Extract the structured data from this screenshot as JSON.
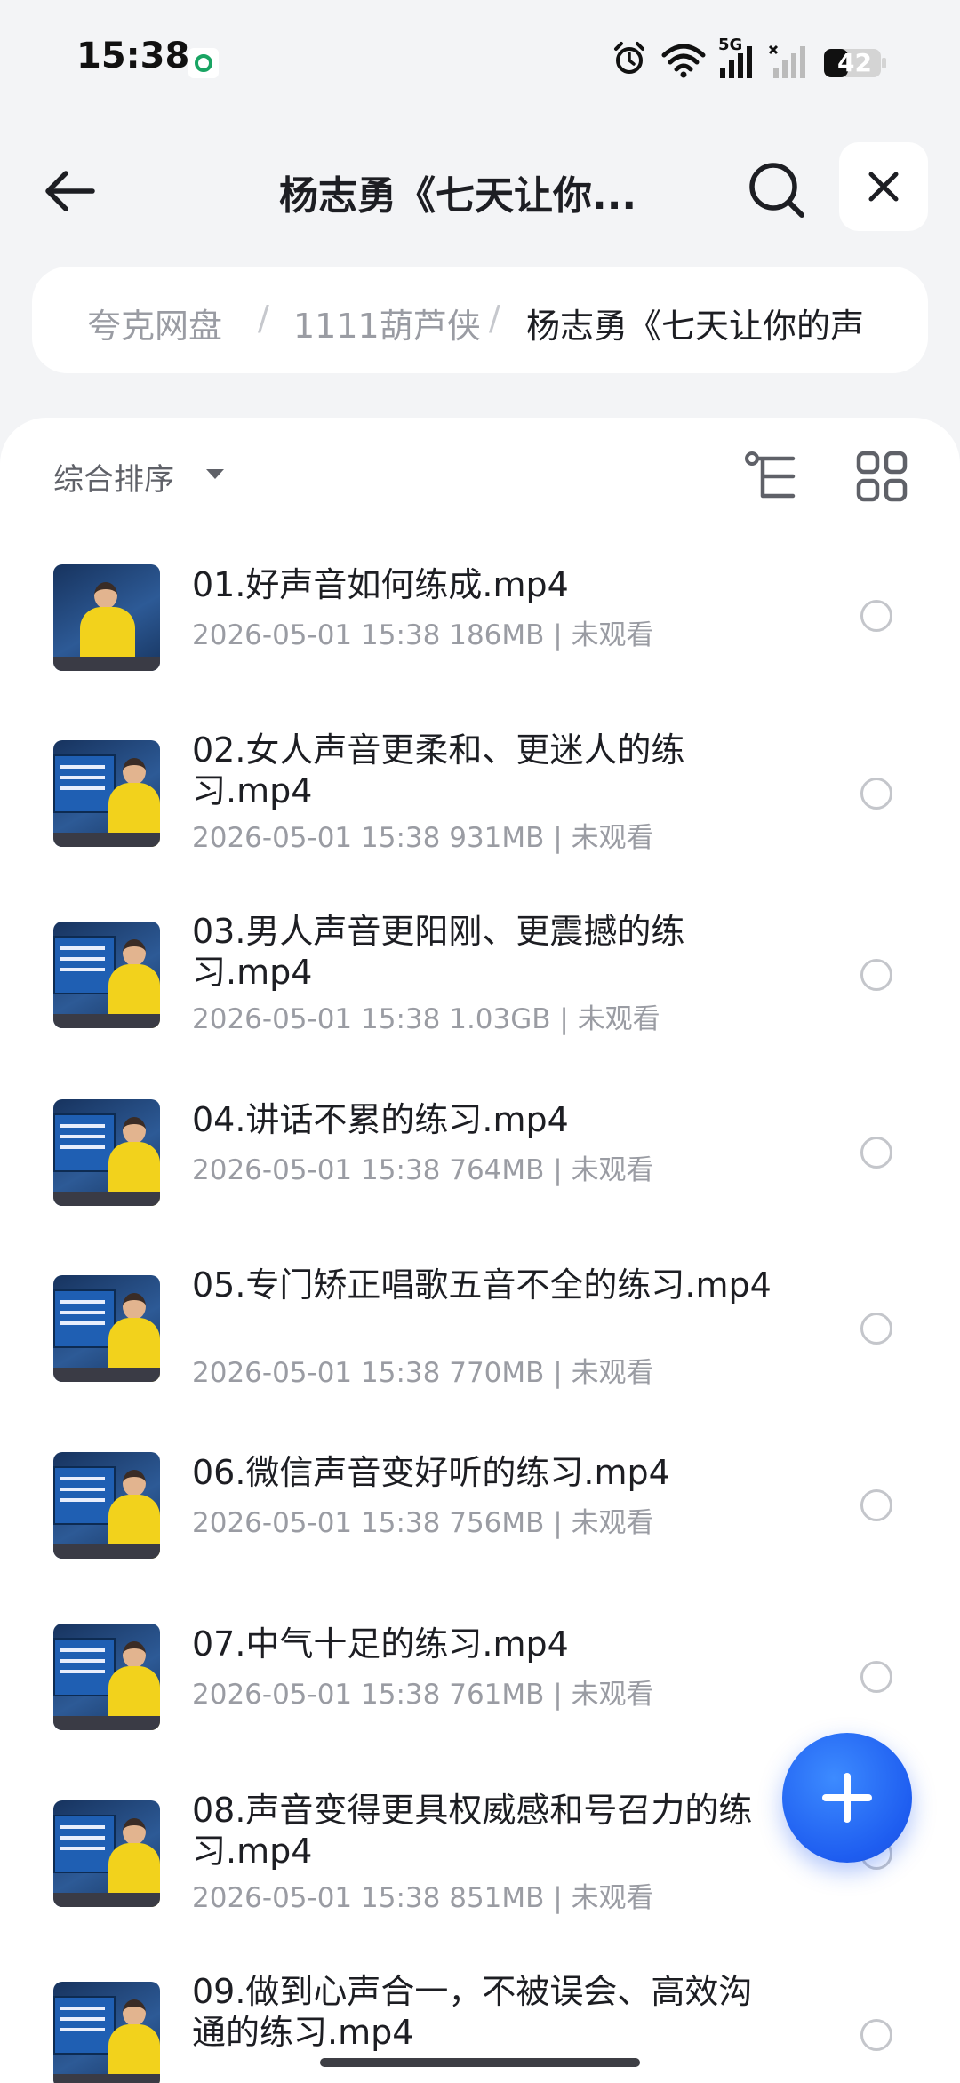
{
  "status_bar": {
    "time": "15:38",
    "battery_level": "42",
    "network_label": "5G",
    "icons": [
      "carrier-icon",
      "alarm-icon",
      "wifi-icon",
      "signal-icon",
      "battery-icon"
    ]
  },
  "header": {
    "title": "杨志勇《七天让你...",
    "back_icon": "arrow-left-icon",
    "search_icon": "search-icon",
    "close_icon": "close-icon"
  },
  "breadcrumb": {
    "items": [
      "夸克网盘",
      "1111葫芦侠",
      "杨志勇《七天让你的声"
    ],
    "separator": "/"
  },
  "toolbar": {
    "sort_label": "综合排序",
    "tree_icon": "folder-tree-icon",
    "grid_icon": "grid-view-icon"
  },
  "files": [
    {
      "name": "01.好声音如何练成.mp4",
      "date": "2026-05-01 15:38",
      "size": "186MB",
      "status": "未观看"
    },
    {
      "name": "02.女人声音更柔和、更迷人的练习.mp4",
      "date": "2026-05-01 15:38",
      "size": "931MB",
      "status": "未观看"
    },
    {
      "name": "03.男人声音更阳刚、更震撼的练习.mp4",
      "date": "2026-05-01 15:38",
      "size": "1.03GB",
      "status": "未观看"
    },
    {
      "name": "04.讲话不累的练习.mp4",
      "date": "2026-05-01 15:38",
      "size": "764MB",
      "status": "未观看"
    },
    {
      "name": "05.专门矫正唱歌五音不全的练习.mp4",
      "date": "2026-05-01 15:38",
      "size": "770MB",
      "status": "未观看"
    },
    {
      "name": "06.微信声音变好听的练习.mp4",
      "date": "2026-05-01 15:38",
      "size": "756MB",
      "status": "未观看"
    },
    {
      "name": "07.中气十足的练习.mp4",
      "date": "2026-05-01 15:38",
      "size": "761MB",
      "status": "未观看"
    },
    {
      "name": "08.声音变得更具权威感和号召力的练习.mp4",
      "date": "2026-05-01 15:38",
      "size": "851MB",
      "status": "未观看"
    },
    {
      "name": "09.做到心声合一，不被误会、高效沟通的练习.mp4",
      "date": "",
      "size": "",
      "status": ""
    }
  ],
  "fab": {
    "icon": "plus-icon"
  },
  "colors": {
    "accent": "#1e5df0",
    "background": "#f3f4f6",
    "panel": "#ffffff"
  }
}
